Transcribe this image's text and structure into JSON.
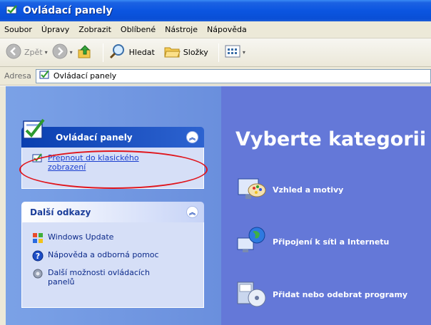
{
  "window": {
    "title": "Ovládací panely"
  },
  "menu": [
    "Soubor",
    "Úpravy",
    "Zobrazit",
    "Oblíbené",
    "Nástroje",
    "Nápověda"
  ],
  "toolbar": {
    "back_label": "Zpět",
    "search_label": "Hledat",
    "folders_label": "Složky"
  },
  "address": {
    "label": "Adresa",
    "value": "Ovládací panely"
  },
  "left_panel": {
    "control_panel_title": "Ovládací panely",
    "switch_link": "Přepnout do klasického zobrazení",
    "other_links_title": "Další odkazy",
    "other_links": [
      "Windows Update",
      "Nápověda a odborná pomoc",
      "Další možnosti ovládacích panelů"
    ]
  },
  "main": {
    "heading": "Vyberte kategorii",
    "categories": [
      "Vzhled a motivy",
      "Připojení k síti a Internetu",
      "Přidat nebo odebrat programy"
    ]
  },
  "colors": {
    "titlebar": "#0b55e0",
    "left_pane": "#7ba2e7",
    "right_pane": "#6478d8",
    "highlight_ellipse": "#e0151c"
  }
}
